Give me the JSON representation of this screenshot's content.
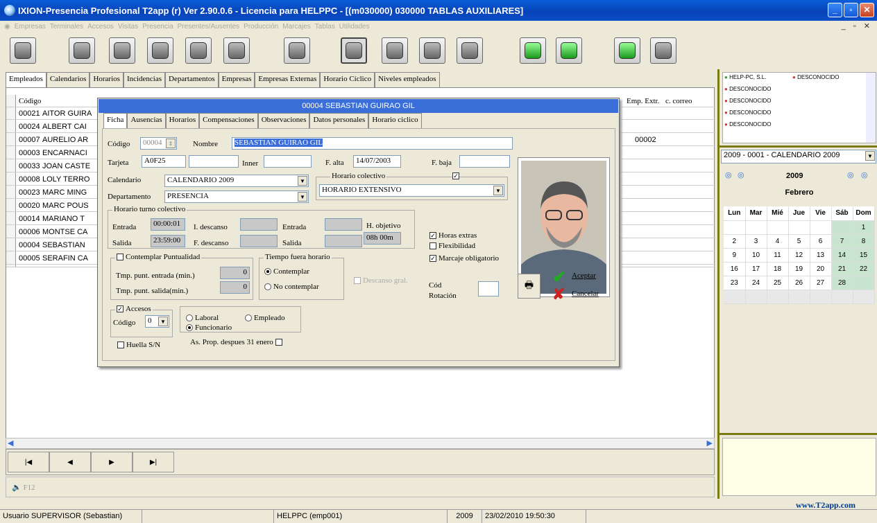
{
  "window": {
    "title": "IXION-Presencia Profesional T2app (r) Ver 2.90.0.6  -  Licencia para HELPPC - [(m030000) 030000 TABLAS AUXILIARES]"
  },
  "menu": [
    "Empresas",
    "Terminales",
    "Accesos",
    "Visitas",
    "Presencia",
    "Presentes/Ausentes",
    "Producción",
    "Marcajes",
    "Tablas",
    "Utilidades"
  ],
  "tabs": [
    "Empleados",
    "Calendarios",
    "Horarios",
    "Incidencias",
    "Departamentos",
    "Empresas",
    "Empresas Externas",
    "Horario Cíclico",
    "Niveles empleados"
  ],
  "grid": {
    "headers": {
      "codigo": "Código",
      "emp_extr": "Emp. Extr.",
      "correo": "c. correo"
    },
    "rows": [
      {
        "code": "00021",
        "name": "AITOR GUIRA",
        "ext": ""
      },
      {
        "code": "00024",
        "name": "ALBERT CAI",
        "ext": ""
      },
      {
        "code": "00007",
        "name": "AURELIO AR",
        "ext": "00002"
      },
      {
        "code": "00003",
        "name": "ENCARNACI",
        "ext": ""
      },
      {
        "code": "00033",
        "name": "JOAN CASTE",
        "ext": ""
      },
      {
        "code": "00008",
        "name": "LOLY TERRO",
        "ext": ""
      },
      {
        "code": "00023",
        "name": "MARC MING",
        "ext": ""
      },
      {
        "code": "00020",
        "name": "MARC POUS",
        "ext": ""
      },
      {
        "code": "00014",
        "name": "MARIANO T",
        "ext": ""
      },
      {
        "code": "00006",
        "name": "MONTSE CA",
        "ext": ""
      },
      {
        "code": "00004",
        "name": "SEBASTIAN",
        "ext": ""
      },
      {
        "code": "00005",
        "name": "SERAFIN CA",
        "ext": ""
      }
    ]
  },
  "dialog": {
    "caption": "00004 SEBASTIAN GUIRAO GIL",
    "tabs": [
      "Ficha",
      "Ausencias",
      "Horarios",
      "Compensaciones",
      "Observaciones",
      "Datos personales",
      "Horario ciclico"
    ],
    "labels": {
      "codigo": "Código",
      "nombre": "Nombre",
      "tarjeta": "Tarjeta",
      "inner": "Inner",
      "falta": "F. alta",
      "fbaja": "F. baja",
      "calendario": "Calendario",
      "horario_colectivo": "Horario colectivo",
      "departamento": "Departamento",
      "horario_turno": "Horario turno colectivo",
      "entrada": "Entrada",
      "idescanso": "I. descanso",
      "entrada2": "Entrada",
      "hobjetivo": "H. objetivo",
      "salida": "Salida",
      "fdescanso": "F. descanso",
      "salida2": "Salida",
      "contemplar_puntualidad": "Contemplar Puntualidad",
      "tmp_entrada": "Tmp. punt. entrada (min.)",
      "tmp_salida": "Tmp. punt. salida(min.)",
      "tiempo_fuera": "Tiempo fuera horario",
      "contemplar": "Contemplar",
      "no_contemplar": "No contemplar",
      "descanso_gral": "Descanso gral.",
      "horas_extras": "Horas extras",
      "flexibilidad": "Flexibilidad",
      "marcaje_obligatorio": "Marcaje obligatorio",
      "cod_rotacion_1": "Cód",
      "cod_rotacion_2": "Rotación",
      "accesos": "Accesos",
      "codigo_acc": "Código",
      "laboral": "Laboral",
      "empleado": "Empleado",
      "funcionario": "Funcionario",
      "huella": "Huella S/N",
      "as_prop": "As. Prop. despues 31 enero",
      "aceptar": "Aceptar",
      "cancelar": "Cancelar"
    },
    "values": {
      "codigo": "00004",
      "nombre": "SEBASTIAN GUIRAO GIL",
      "tarjeta": "A0F25",
      "falta": "14/07/2003",
      "calendario": "CALENDARIO 2009",
      "departamento": "PRESENCIA",
      "horario_colectivo": "HORARIO EXTENSIVO",
      "entrada": "00:00:01",
      "salida": "23:59:00",
      "hobjetivo": "08h 00m",
      "tmp_entrada": "0",
      "tmp_salida": "0",
      "acc_codigo": "0"
    }
  },
  "right": {
    "companies": [
      "HELP-PC, S.L.",
      "DESCONOCIDO",
      "DESCONOCIDO",
      "DESCONOCIDO",
      "DESCONOCIDO",
      "DESCONOCIDO"
    ],
    "calendar_select": "2009 - 0001 - CALENDARIO 2009",
    "year": "2009",
    "month": "Febrero",
    "weekdays": [
      "Lun",
      "Mar",
      "Mié",
      "Jue",
      "Vie",
      "Sáb",
      "Dom"
    ],
    "weeks": [
      [
        "",
        "",
        "",
        "",
        "",
        "",
        "1"
      ],
      [
        "2",
        "3",
        "4",
        "5",
        "6",
        "7",
        "8"
      ],
      [
        "9",
        "10",
        "11",
        "12",
        "13",
        "14",
        "15"
      ],
      [
        "16",
        "17",
        "18",
        "19",
        "20",
        "21",
        "22"
      ],
      [
        "23",
        "24",
        "25",
        "26",
        "27",
        "28",
        ""
      ],
      [
        "",
        "",
        "",
        "",
        "",
        "",
        ""
      ]
    ],
    "website": "www.T2app.com"
  },
  "f12": "F12",
  "status": {
    "user": "Usuario SUPERVISOR (Sebastian)",
    "company": "HELPPC  (emp001)",
    "year": "2009",
    "datetime": "23/02/2010 19:50:30"
  },
  "colors": {
    "weekend_bg": "#c9e4cf",
    "title_blue": "#0a4fc8",
    "accent_olive": "#7a7a12"
  }
}
